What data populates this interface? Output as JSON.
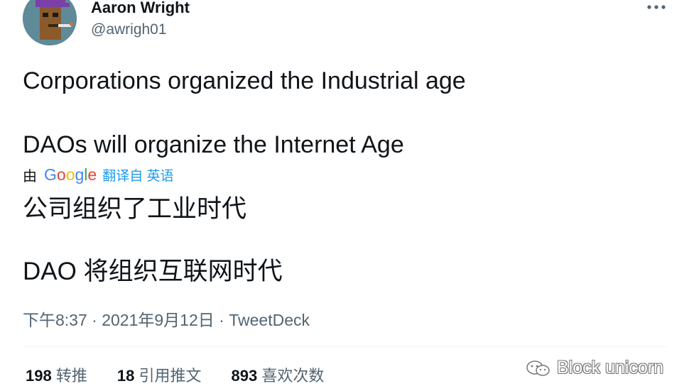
{
  "author": {
    "name": "Aaron Wright",
    "handle": "@awrigh01"
  },
  "menu_icon": "more-horizontal-icon",
  "tweet": {
    "line1": "Corporations organized the Industrial age",
    "line2": "DAOs will organize the Internet Age"
  },
  "translation": {
    "by": "由",
    "provider": "Google",
    "link": "翻译自 英语",
    "line1": "公司组织了工业时代",
    "line2": "DAO 将组织互联网时代"
  },
  "meta": {
    "time": "下午8:37",
    "date": "2021年9月12日",
    "source": "TweetDeck",
    "separator": "·"
  },
  "stats": [
    {
      "count": "198",
      "label": "转推"
    },
    {
      "count": "18",
      "label": "引用推文"
    },
    {
      "count": "893",
      "label": "喜欢次数"
    }
  ],
  "watermark": {
    "text": "Block unicorn"
  },
  "colors": {
    "text": "#0f1419",
    "secondary": "#536471",
    "link": "#1d9bf0"
  }
}
